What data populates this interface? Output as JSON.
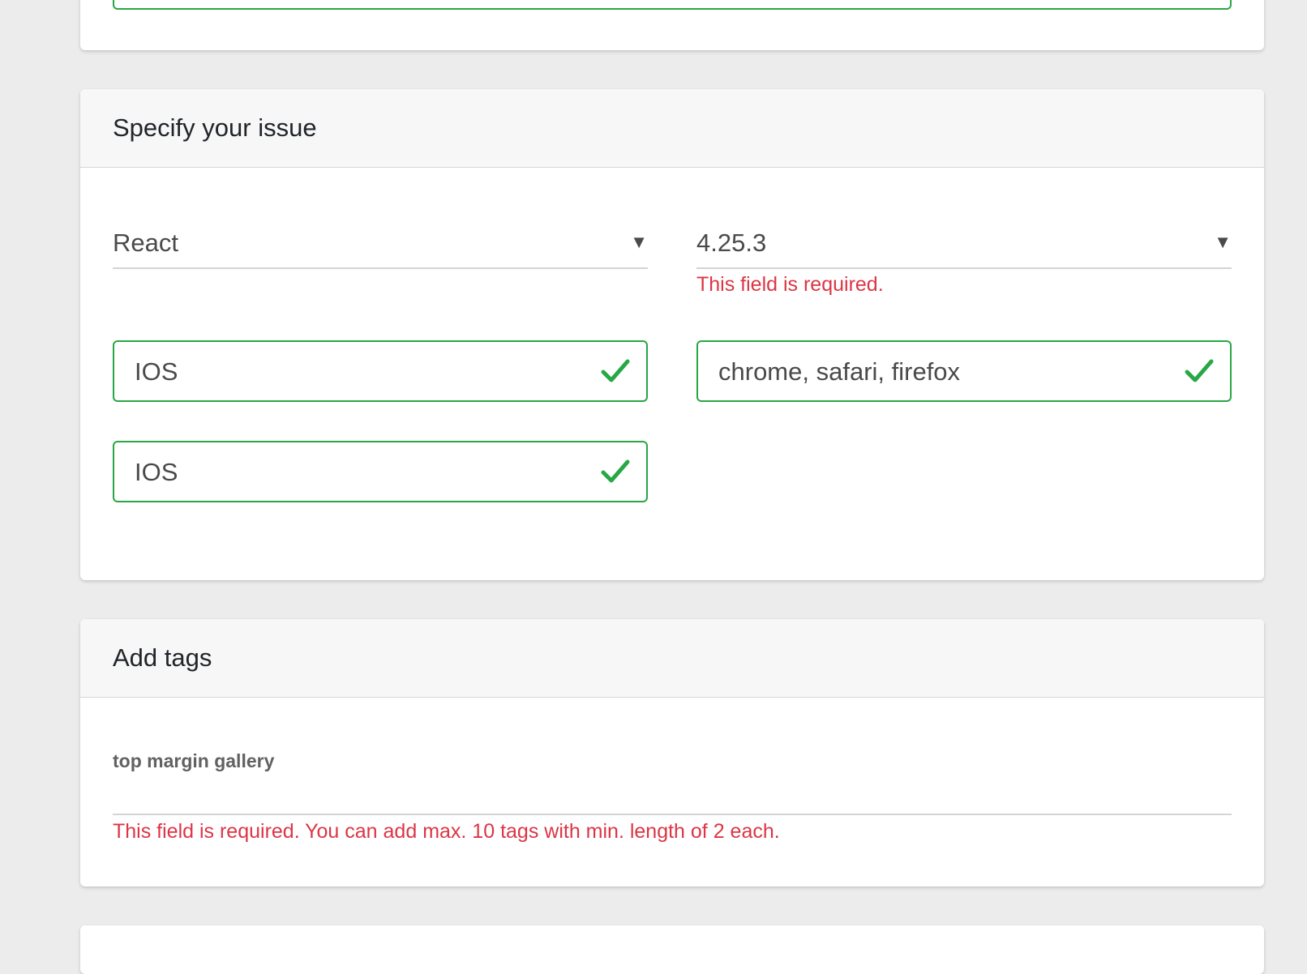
{
  "colors": {
    "page_background": "#ececec",
    "card_background": "#ffffff",
    "header_background": "#f7f7f7",
    "valid_border": "#28a745",
    "error_text": "#dc3545"
  },
  "issue_section": {
    "title": "Specify your issue",
    "framework_select": {
      "value": "React",
      "arrow_icon": "triangle-down-icon"
    },
    "version_select": {
      "value": "4.25.3",
      "arrow_icon": "triangle-down-icon",
      "error": "This field is required."
    },
    "os_input": {
      "value": "IOS",
      "valid_icon": "check-icon"
    },
    "browsers_input": {
      "value": "chrome, safari, firefox",
      "valid_icon": "check-icon"
    },
    "os_input_2": {
      "value": "IOS",
      "valid_icon": "check-icon"
    }
  },
  "tags_section": {
    "title": "Add tags",
    "tags_label": "top margin gallery",
    "error": "This field is required. You can add max. 10 tags with min. length of 2 each."
  }
}
